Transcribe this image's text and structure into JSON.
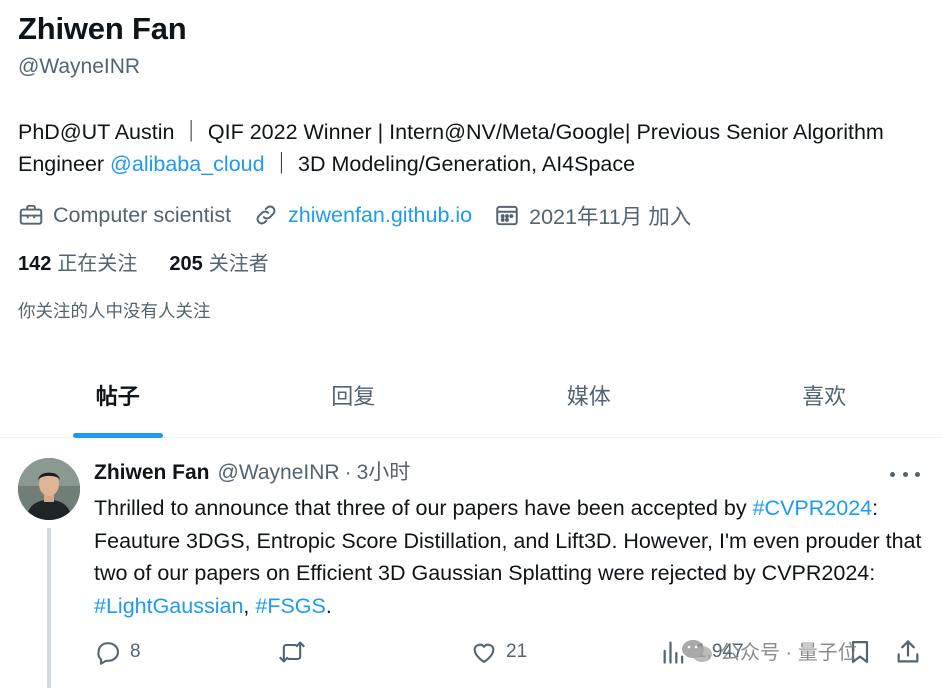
{
  "profile": {
    "name": "Zhiwen Fan",
    "handle": "@WayneINR",
    "bio_part1": "PhD@UT Austin ｜ QIF 2022 Winner | Intern@NV/Meta/Google| Previous Senior Algorithm Engineer ",
    "bio_link": "@alibaba_cloud",
    "bio_part2": "｜ 3D Modeling/Generation, AI4Space",
    "profession": "Computer scientist",
    "website": "zhiwenfan.github.io",
    "joined": "2021年11月 加入",
    "following_count": "142",
    "following_label": "正在关注",
    "followers_count": "205",
    "followers_label": "关注者",
    "followed_by_note": "你关注的人中没有人关注"
  },
  "tabs": [
    {
      "label": "帖子",
      "active": true
    },
    {
      "label": "回复",
      "active": false
    },
    {
      "label": "媒体",
      "active": false
    },
    {
      "label": "喜欢",
      "active": false
    }
  ],
  "tweet": {
    "author_name": "Zhiwen Fan",
    "author_handle": "@WayneINR",
    "separator": "·",
    "time": "3小时",
    "text_1": "Thrilled to announce that three of our papers have been accepted by ",
    "hashtag_1": "#CVPR2024",
    "text_2": ": Feauture 3DGS, Entropic Score Distillation, and Lift3D. However, I'm even prouder that two of our papers on Efficient 3D Gaussian Splatting were rejected by CVPR2024: ",
    "hashtag_2": "#LightGaussian",
    "text_3": ", ",
    "hashtag_3": "#FSGS",
    "text_4": ".",
    "replies": "8",
    "retweets": "",
    "likes": "21",
    "views": "1,947"
  },
  "watermark": {
    "text": "公众号 · 量子位"
  },
  "colors": {
    "accent": "#1d9bf0",
    "text_primary": "#0f1419",
    "text_secondary": "#536471",
    "divider": "#eff3f4"
  },
  "icons": {
    "profession": "briefcase-icon",
    "website": "link-icon",
    "joined": "calendar-icon",
    "more": "more-dots-icon",
    "reply": "reply-icon",
    "retweet": "retweet-icon",
    "like": "heart-icon",
    "views": "views-chart-icon",
    "bookmark": "bookmark-icon",
    "share": "share-icon",
    "watermark": "wechat-icon"
  }
}
